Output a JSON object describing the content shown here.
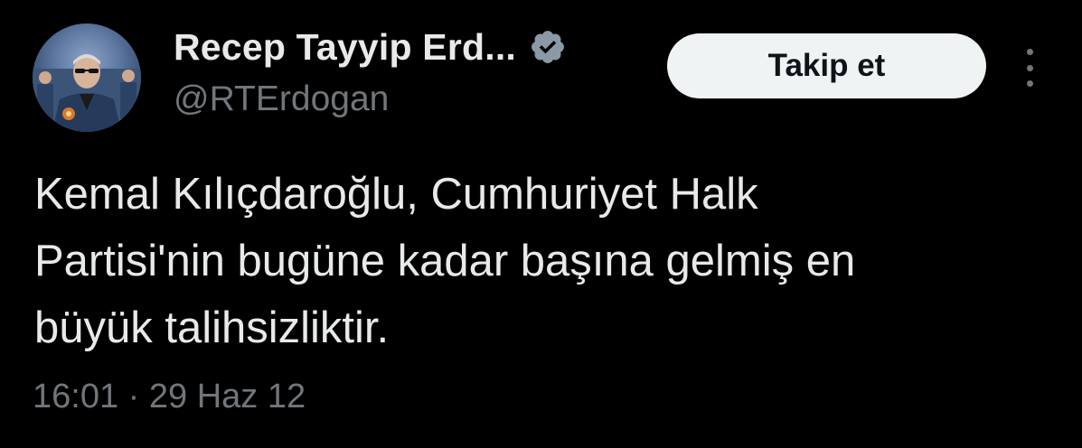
{
  "author": {
    "display_name": "Recep Tayyip Erd...",
    "handle": "@RTErdogan",
    "verified_icon": "verified-badge-icon",
    "avatar_icon": "profile-photo"
  },
  "actions": {
    "follow_label": "Takip et",
    "more_icon": "more-vertical-icon"
  },
  "tweet": {
    "text": "Kemal Kılıçdaroğlu, Cumhuriyet Halk\nPartisi'nin bugüne kadar başına gelmiş en\nbüyük talihsizliktir.",
    "timestamp": "16:01 · 29 Haz 12"
  },
  "colors": {
    "background": "#000000",
    "primary_text": "#e7e9ea",
    "secondary_text": "#71767b",
    "button_bg": "#eff3f4",
    "button_text": "#0f1419",
    "verified": "#8b98a5"
  }
}
